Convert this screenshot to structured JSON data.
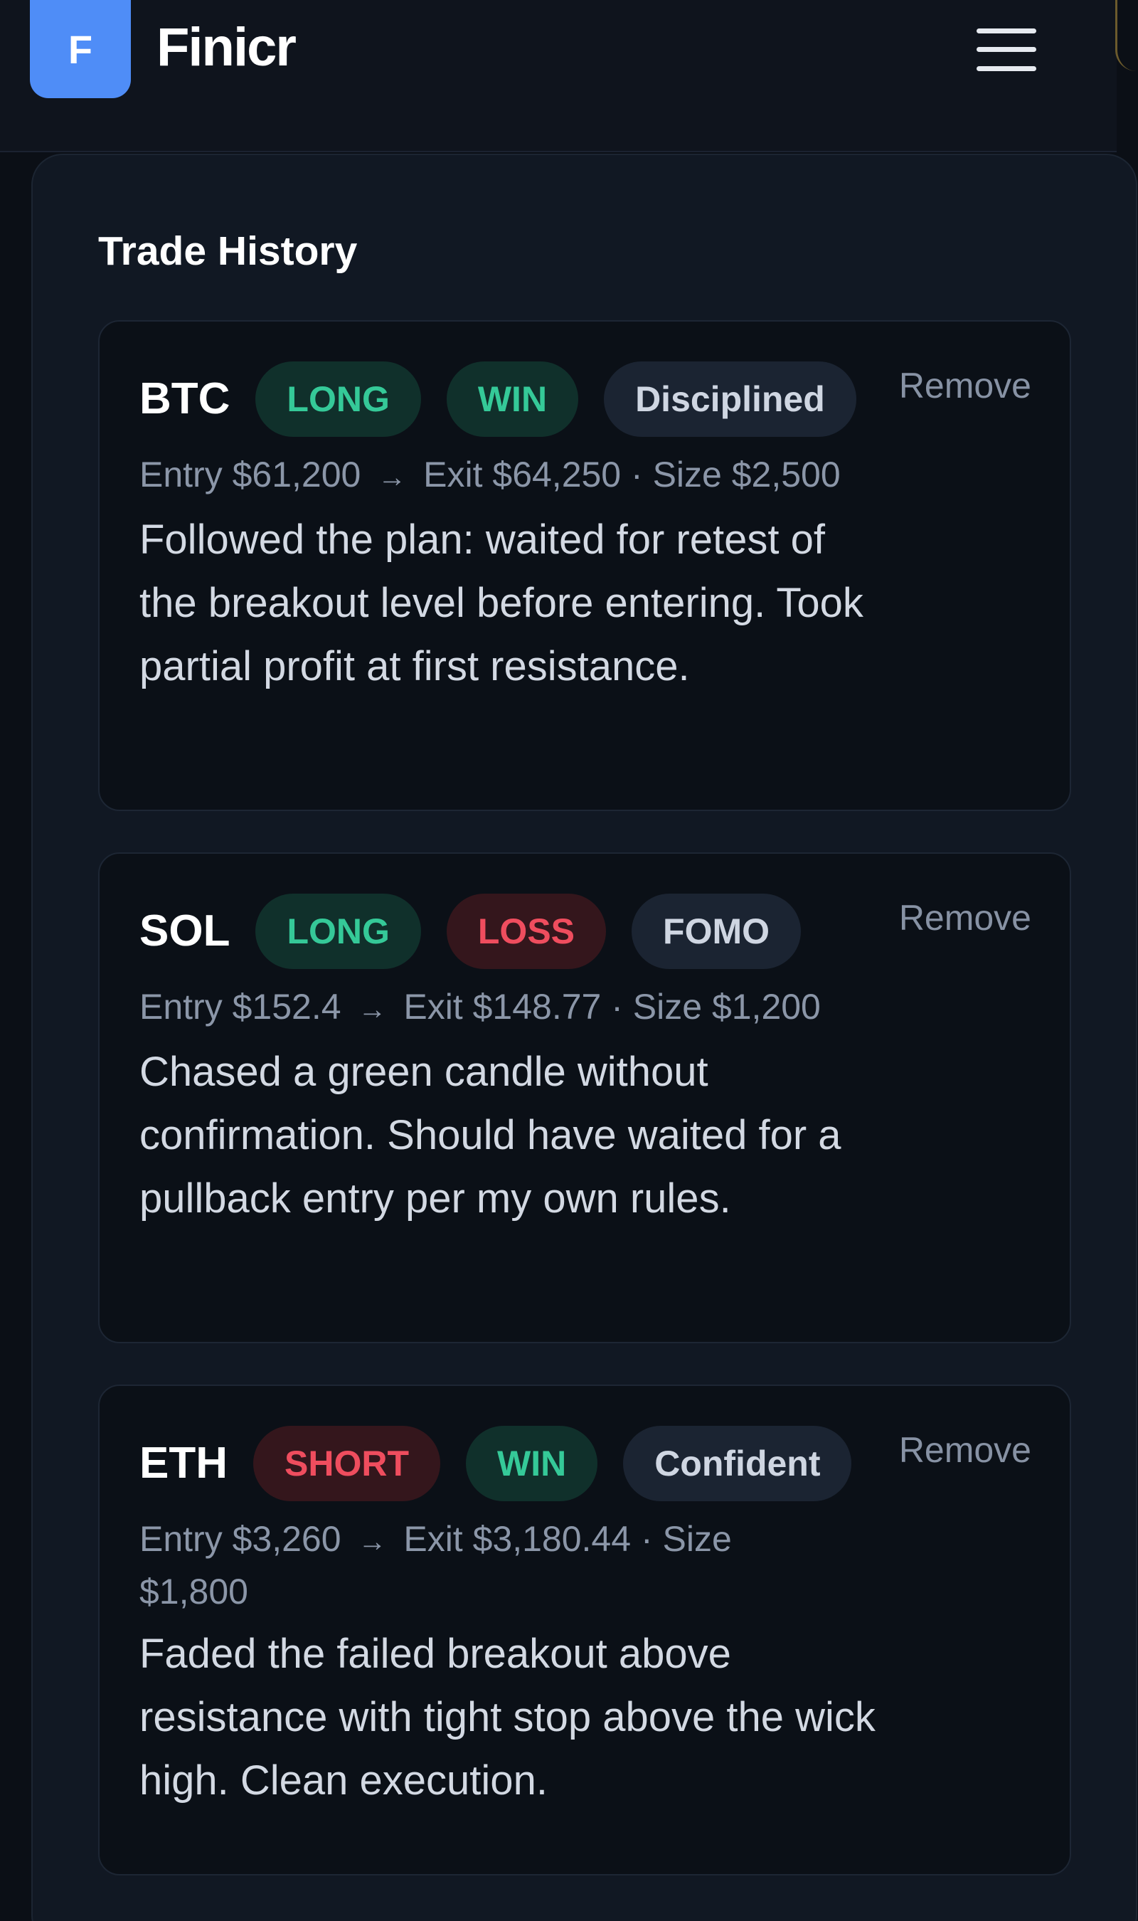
{
  "header": {
    "logo_letter": "F",
    "brand": "Finicr",
    "menu_icon": "hamburger-menu-icon"
  },
  "panel": {
    "title": "Trade History"
  },
  "trades": [
    {
      "symbol": "BTC",
      "direction": "LONG",
      "outcome": "WIN",
      "emotion": "Disciplined",
      "entry": "Entry $61,200",
      "exit": "Exit $64,250",
      "size": "Size $2,500",
      "note": "Followed the plan: waited for retest of the breakout level before entering. Took partial profit at first resistance.",
      "remove_label": "Remove"
    },
    {
      "symbol": "SOL",
      "direction": "LONG",
      "outcome": "LOSS",
      "emotion": "FOMO",
      "entry": "Entry $152.4",
      "exit": "Exit $148.77",
      "size": "Size $1,200",
      "note": "Chased a green candle without confirmation. Should have waited for a pullback entry per my own rules.",
      "remove_label": "Remove"
    },
    {
      "symbol": "ETH",
      "direction": "SHORT",
      "outcome": "WIN",
      "emotion": "Confident",
      "entry": "Entry $3,260",
      "exit": "Exit $3,180.44",
      "size": "Size $1,800",
      "note": "Faded the failed breakout above resistance with tight stop above the wick high. Clean execution.",
      "remove_label": "Remove"
    }
  ],
  "colors": {
    "accent": "#4f8df7",
    "positive": "#35c998",
    "negative": "#ef4d5e",
    "background": "#0b0f16",
    "panel": "#111823"
  }
}
